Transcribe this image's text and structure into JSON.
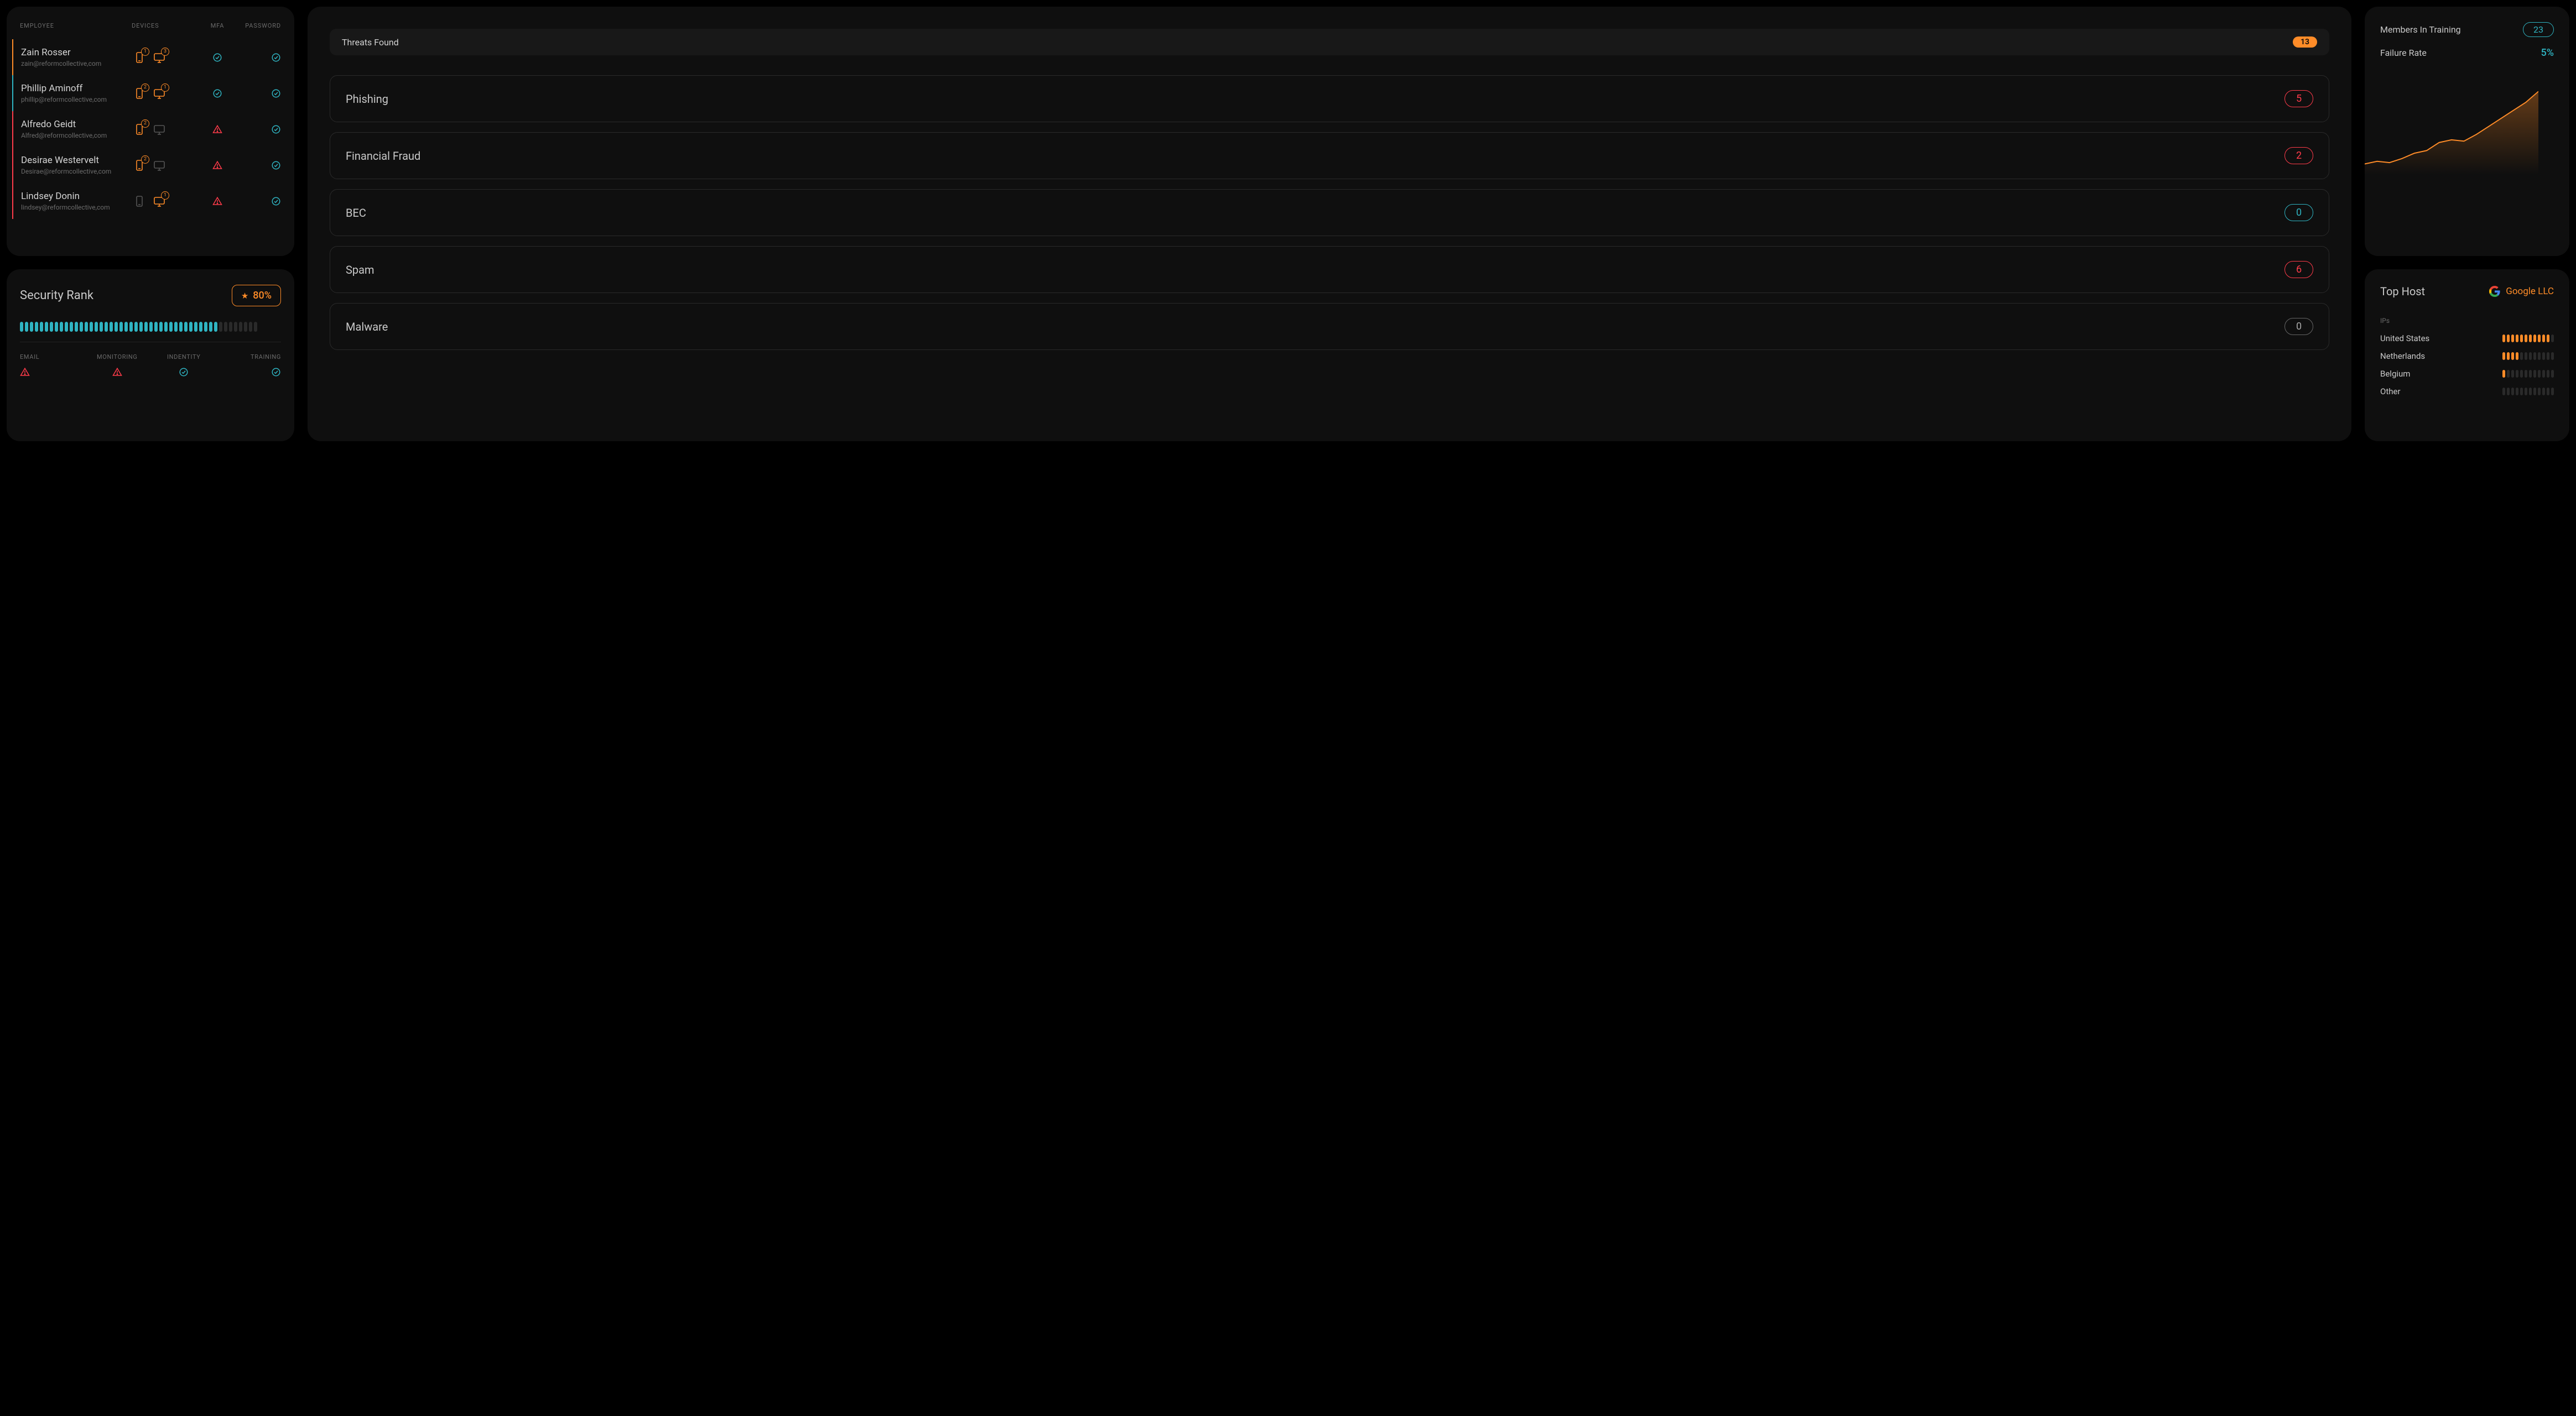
{
  "employees": {
    "headers": {
      "name": "EMPLOYEE",
      "devices": "DEVICES",
      "mfa": "MFA",
      "password": "PASSWORD"
    },
    "rows": [
      {
        "name": "Zain Rosser",
        "email": "zain@reformcollective,com",
        "accent": "#ff8c28",
        "phone": 1,
        "desktop": 3,
        "mfa": "ok",
        "password": "ok"
      },
      {
        "name": "Phillip Aminoff",
        "email": "phillip@reformcollective,com",
        "accent": "#2fb4c2",
        "phone": 2,
        "desktop": 1,
        "mfa": "ok",
        "password": "ok"
      },
      {
        "name": "Alfredo Geidt",
        "email": "Alfred@reformcollective,com",
        "accent": "#ff3b4a",
        "phone": 2,
        "desktop": 0,
        "mfa": "warn",
        "password": "ok"
      },
      {
        "name": "Desirae Westervelt",
        "email": "Desirae@reformcollective,com",
        "accent": "#ff3b4a",
        "phone": 2,
        "desktop": 0,
        "mfa": "warn",
        "password": "ok"
      },
      {
        "name": "Lindsey Donin",
        "email": "lindsey@reformcollective,com",
        "accent": "#ff3b4a",
        "phone": 0,
        "desktop": 1,
        "mfa": "warn",
        "password": "ok"
      }
    ]
  },
  "security_rank": {
    "title": "Security Rank",
    "badge": "80%",
    "ticks_total": 48,
    "ticks_on": 40,
    "categories": [
      {
        "label": "EMAIL",
        "status": "warn"
      },
      {
        "label": "MONITORING",
        "status": "warn"
      },
      {
        "label": "INDENTITY",
        "status": "ok"
      },
      {
        "label": "TRAINING",
        "status": "ok"
      }
    ]
  },
  "threats": {
    "header_label": "Threats Found",
    "header_count": "13",
    "items": [
      {
        "name": "Phishing",
        "count": "5",
        "tone": "r"
      },
      {
        "name": "Financial Fraud",
        "count": "2",
        "tone": "r"
      },
      {
        "name": "BEC",
        "count": "0",
        "tone": "b"
      },
      {
        "name": "Spam",
        "count": "6",
        "tone": "r"
      },
      {
        "name": "Malware",
        "count": "0",
        "tone": "g"
      }
    ]
  },
  "training": {
    "members_label": "Members In Training",
    "members_count": "23",
    "failure_label": "Failure Rate",
    "failure_value": "5%"
  },
  "top_host": {
    "title": "Top Host",
    "name": "Google LLC",
    "ips_label": "IPs",
    "rows": [
      {
        "country": "United States",
        "on": 11,
        "total": 12
      },
      {
        "country": "Netherlands",
        "on": 4,
        "total": 12
      },
      {
        "country": "Belgium",
        "on": 1,
        "total": 12
      },
      {
        "country": "Other",
        "on": 0,
        "total": 12
      }
    ]
  },
  "chart_data": {
    "type": "area",
    "title": "",
    "x": [
      0,
      1,
      2,
      3,
      4,
      5,
      6,
      7,
      8,
      9,
      10,
      11,
      12,
      13,
      14
    ],
    "values": [
      8,
      10,
      9,
      12,
      16,
      18,
      24,
      26,
      25,
      30,
      36,
      42,
      48,
      54,
      62
    ],
    "ylim": [
      0,
      70
    ],
    "color": "#ff8c28"
  }
}
